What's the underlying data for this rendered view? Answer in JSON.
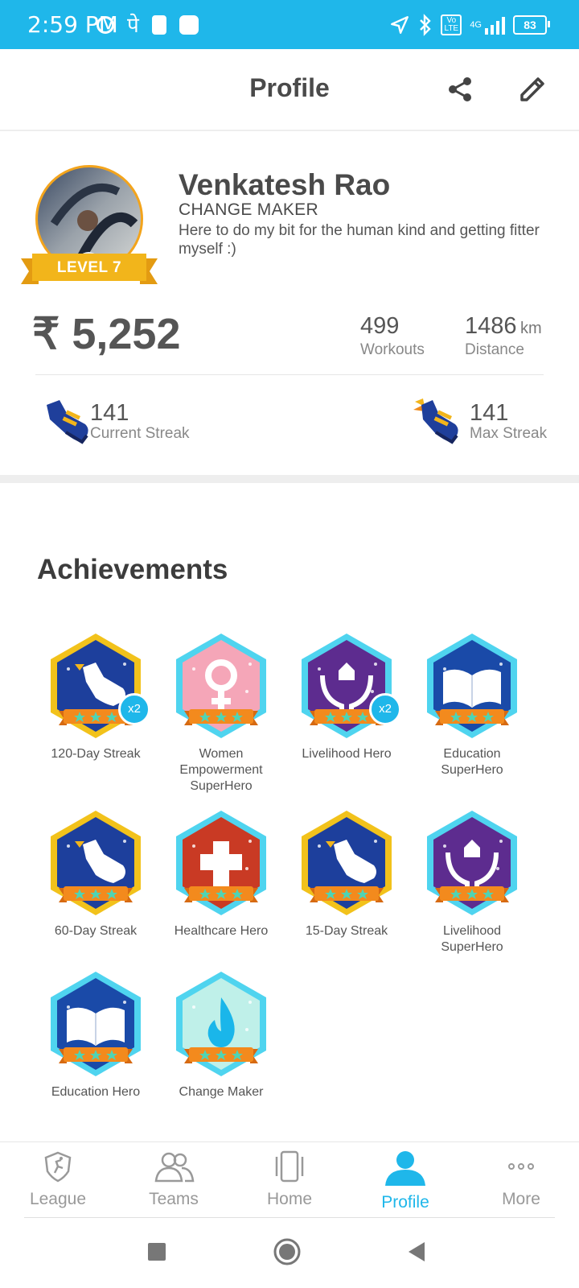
{
  "status_bar": {
    "time": "2:59 PM",
    "network": "4G",
    "volte": "Vo LTE",
    "battery": "83",
    "hindi_glyph": "पे"
  },
  "header": {
    "title": "Profile",
    "share_icon": "share-icon",
    "edit_icon": "pencil-icon"
  },
  "profile": {
    "name": "Venkatesh Rao",
    "title": "CHANGE MAKER",
    "bio": "Here to do my bit for the human kind and getting fitter myself :)",
    "level": "LEVEL 7",
    "amount": "₹ 5,252",
    "workouts_value": "499",
    "workouts_label": "Workouts",
    "distance_value": "1486",
    "distance_unit": "km",
    "distance_label": "Distance",
    "current_streak_value": "141",
    "current_streak_label": "Current Streak",
    "max_streak_value": "141",
    "max_streak_label": "Max Streak"
  },
  "achievements": {
    "title": "Achievements",
    "badges": [
      {
        "label": "120-Day Streak",
        "icon": "shoe-icon",
        "multiplier": "x2"
      },
      {
        "label": "Women Empowerment SuperHero",
        "icon": "female-symbol-icon",
        "multiplier": ""
      },
      {
        "label": "Livelihood Hero",
        "icon": "house-hands-icon",
        "multiplier": "x2"
      },
      {
        "label": "Education SuperHero",
        "icon": "book-icon",
        "multiplier": ""
      },
      {
        "label": "60-Day Streak",
        "icon": "shoe-icon",
        "multiplier": ""
      },
      {
        "label": "Healthcare Hero",
        "icon": "medical-cross-icon",
        "multiplier": ""
      },
      {
        "label": "15-Day Streak",
        "icon": "shoe-icon",
        "multiplier": ""
      },
      {
        "label": "Livelihood SuperHero",
        "icon": "house-hands-icon",
        "multiplier": ""
      },
      {
        "label": "Education Hero",
        "icon": "book-icon",
        "multiplier": ""
      },
      {
        "label": "Change Maker",
        "icon": "flame-icon",
        "multiplier": ""
      }
    ]
  },
  "bottom_nav": {
    "items": [
      {
        "label": "League",
        "icon": "shield-runner-icon"
      },
      {
        "label": "Teams",
        "icon": "people-icon"
      },
      {
        "label": "Home",
        "icon": "phone-icon"
      },
      {
        "label": "Profile",
        "icon": "person-icon"
      },
      {
        "label": "More",
        "icon": "ellipsis-icon"
      }
    ],
    "active": "Profile"
  },
  "colors": {
    "accent": "#1fb7ea",
    "ribbon": "#f2b51b",
    "text": "#4a4a4a"
  }
}
